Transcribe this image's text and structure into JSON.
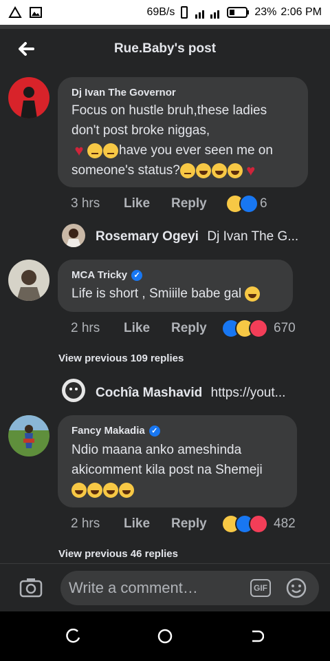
{
  "status_bar": {
    "speed": "69B/s",
    "battery": "23%",
    "time": "2:06 PM"
  },
  "header": {
    "title": "Rue.Baby's post"
  },
  "comments": [
    {
      "author": "Dj Ivan The Governor",
      "lines": [
        "Focus on hustle bruh,these ladies",
        "don't post broke niggas,",
        "have you ever seen me on",
        "someone's status?"
      ],
      "time": "3 hrs",
      "like": "Like",
      "reply": "Reply",
      "reactions": "6",
      "reply_preview": {
        "name": "Rosemary Ogeyi",
        "text": "Dj Ivan The G..."
      }
    },
    {
      "author": "MCA Tricky",
      "lines": [
        "Life is short , Smiiile babe gal"
      ],
      "time": "2 hrs",
      "like": "Like",
      "reply": "Reply",
      "reactions": "670",
      "view_previous": "View previous 109 replies",
      "reply_preview": {
        "name": "Cochîa Mashavid",
        "text": "https://yout..."
      }
    },
    {
      "author": "Fancy Makadia",
      "lines": [
        "Ndio maana anko ameshinda",
        "akicomment kila post na Shemeji"
      ],
      "time": "2 hrs",
      "like": "Like",
      "reply": "Reply",
      "reactions": "482",
      "view_previous": "View previous 46 replies"
    }
  ],
  "composer": {
    "placeholder": "Write a comment…",
    "gif_label": "GIF"
  },
  "icons": {
    "back": "arrow-left-icon",
    "camera": "camera-icon",
    "gif": "gif-icon",
    "emoji": "smiley-icon",
    "nav_back": "nav-back-icon",
    "nav_home": "home-circle-icon",
    "nav_recent": "recents-icon"
  },
  "colors": {
    "background": "#242526",
    "bubble": "#3a3b3c",
    "link": "#1877f2"
  }
}
